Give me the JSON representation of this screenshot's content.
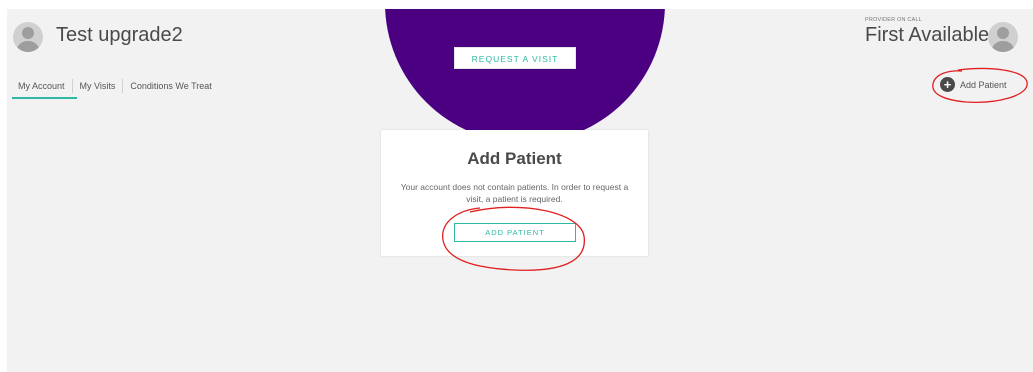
{
  "header": {
    "user_name": "Test upgrade2",
    "provider_label": "PROVIDER ON CALL",
    "provider_name": "First Available",
    "request_visit_label": "REQUEST A VISIT",
    "banner_color": "#4b0082",
    "accent_color": "#2fb8a4"
  },
  "nav": {
    "tabs": [
      {
        "label": "My Account",
        "active": true
      },
      {
        "label": "My Visits",
        "active": false
      },
      {
        "label": "Conditions We Treat",
        "active": false
      }
    ],
    "add_patient_label": "Add Patient",
    "add_patient_icon": "plus-circle-icon"
  },
  "card": {
    "title": "Add Patient",
    "message": "Your account does not contain patients. In order to request a visit, a patient is required.",
    "button_label": "ADD PATIENT"
  },
  "annotations": {
    "color": "#e02020"
  }
}
